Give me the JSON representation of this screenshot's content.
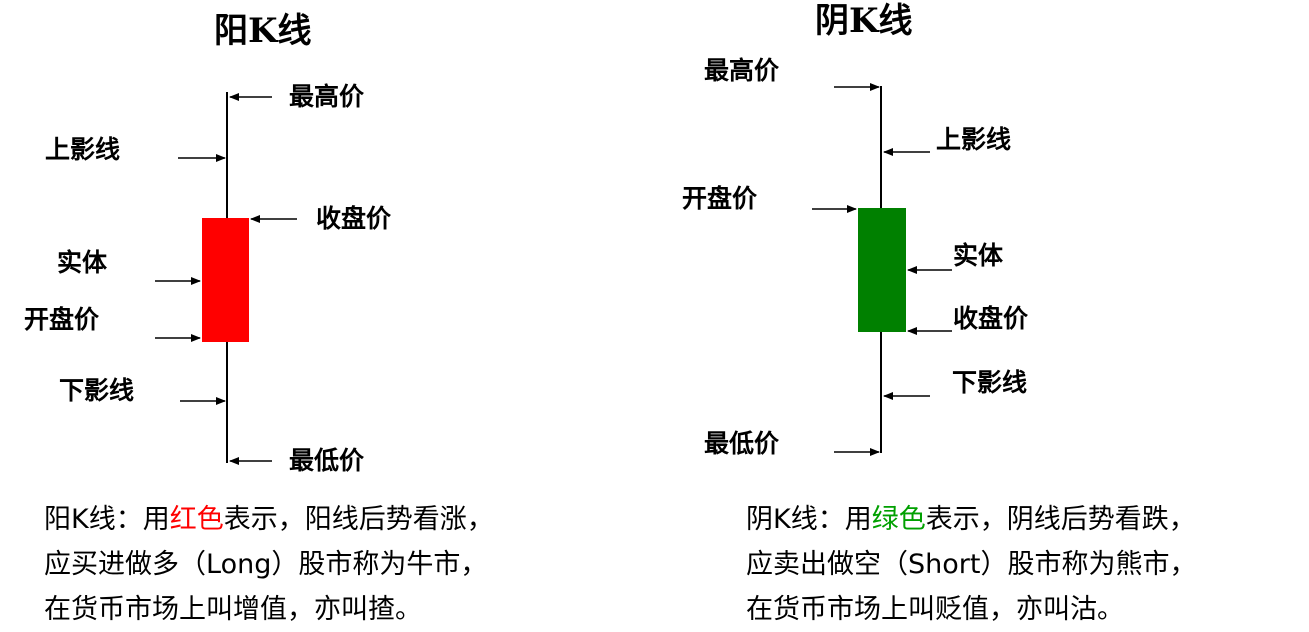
{
  "yang": {
    "title": "阳K线",
    "labels": {
      "high": "最高价",
      "upper_shadow": "上影线",
      "close": "收盘价",
      "body": "实体",
      "open": "开盘价",
      "lower_shadow": "下影线",
      "low": "最低价"
    },
    "body_color": "#ff0000",
    "desc": {
      "line1_pre": "阳K线：用",
      "line1_color": "红色",
      "line1_post": "表示，阳线后势看涨，",
      "line2": "应买进做多（Long）股市称为牛市，",
      "line3": "在货币市场上叫增值，亦叫揸。"
    }
  },
  "yin": {
    "title": "阴K线",
    "labels": {
      "high": "最高价",
      "upper_shadow": "上影线",
      "open": "开盘价",
      "body": "实体",
      "close": "收盘价",
      "lower_shadow": "下影线",
      "low": "最低价"
    },
    "body_color": "#008000",
    "desc": {
      "line1_pre": "阴K线：用",
      "line1_color": "绿色",
      "line1_post": "表示，阴线后势看跌，",
      "line2": "应卖出做空（Short）股市称为熊市，",
      "line3": "在货币市场上叫贬值，亦叫沽。"
    }
  }
}
